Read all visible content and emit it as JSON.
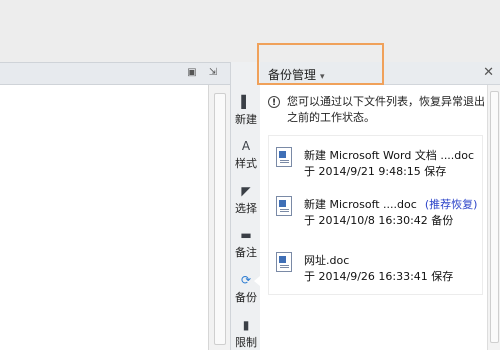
{
  "doc_toolbar": {
    "icons": [
      "pin-icon",
      "panel-toggle-icon"
    ]
  },
  "rail": {
    "items": [
      {
        "label": "新建",
        "icon": "new-icon"
      },
      {
        "label": "样式",
        "icon": "style-icon"
      },
      {
        "label": "选择",
        "icon": "select-icon"
      },
      {
        "label": "备注",
        "icon": "note-icon"
      },
      {
        "label": "备份",
        "icon": "backup-icon",
        "active": true
      },
      {
        "label": "限制",
        "icon": "restrict-icon"
      }
    ]
  },
  "panel": {
    "title": "备份管理",
    "info": "您可以通过以下文件列表，恢复异常退出之前的工作状态。",
    "files": [
      {
        "name": "新建 Microsoft Word 文档 ....doc",
        "meta": "于 2014/9/21 9:48:15 保存",
        "tag": ""
      },
      {
        "name": "新建 Microsoft ....doc",
        "meta": "于 2014/10/8 16:30:42 备份",
        "tag": "(推荐恢复)"
      },
      {
        "name": "网址.doc",
        "meta": "于 2014/9/26 16:33:41 保存",
        "tag": ""
      }
    ]
  },
  "colors": {
    "highlight": "#f0a15a",
    "accent": "#2c44c9"
  }
}
